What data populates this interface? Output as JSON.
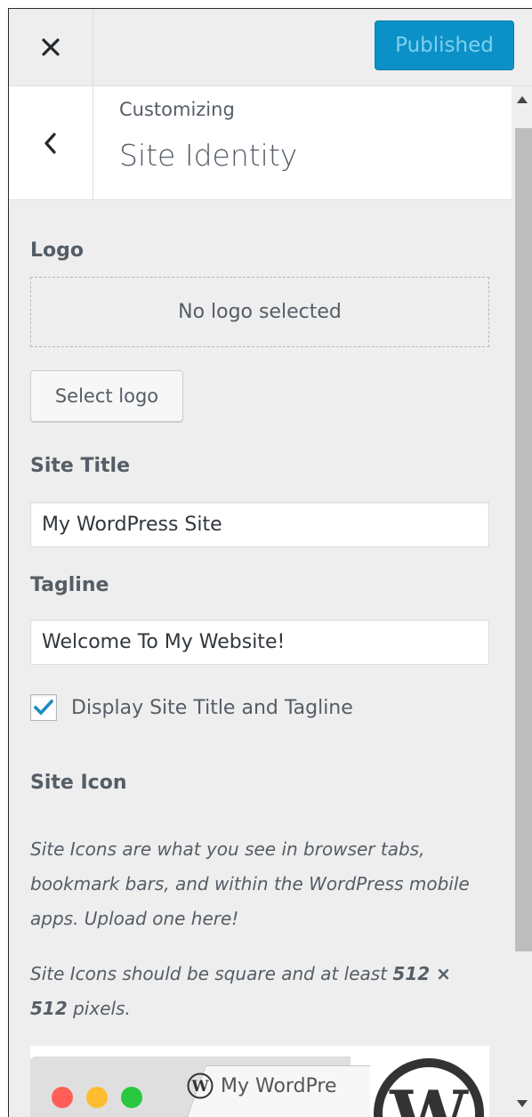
{
  "header": {
    "close_icon": "close-icon",
    "publish_label": "Published"
  },
  "section": {
    "back_icon": "chevron-left-icon",
    "breadcrumb": "Customizing",
    "title": "Site Identity"
  },
  "logo": {
    "label": "Logo",
    "empty_text": "No logo selected",
    "select_button": "Select logo"
  },
  "site_title": {
    "label": "Site Title",
    "value": "My WordPress Site"
  },
  "tagline": {
    "label": "Tagline",
    "value": "Welcome To My Website!"
  },
  "display_toggle": {
    "label": "Display Site Title and Tagline",
    "checked": true
  },
  "site_icon": {
    "label": "Site Icon",
    "description": "Site Icons are what you see in browser tabs, bookmark bars, and within the WordPress mobile apps. Upload one here!",
    "size_note_prefix": "Site Icons should be square and at least ",
    "size_note_bold": "512 × 512",
    "size_note_suffix": " pixels.",
    "preview_tab_title": "My WordPre"
  },
  "colors": {
    "accent": "#0b91c8",
    "traffic_red": "#ff5f57",
    "traffic_yellow": "#febc2e",
    "traffic_green": "#28c840"
  }
}
